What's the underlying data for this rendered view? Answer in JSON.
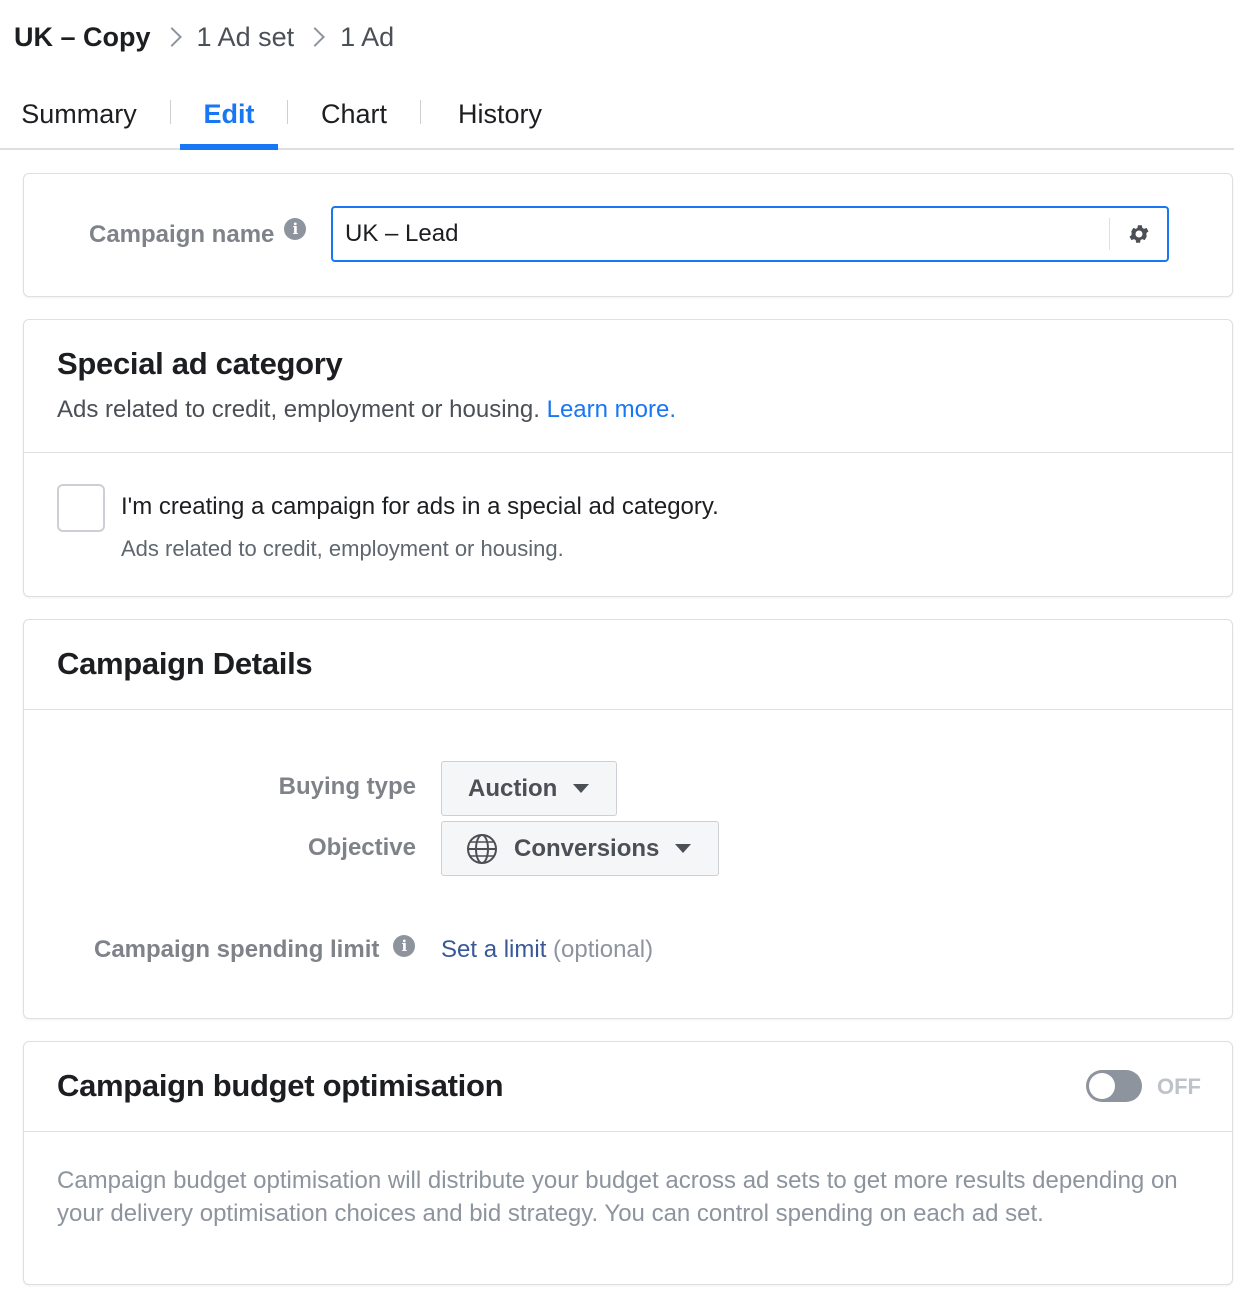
{
  "breadcrumb": {
    "current": "UK – Copy",
    "items": [
      "1 Ad set",
      "1 Ad"
    ]
  },
  "tabs": [
    {
      "label": "Summary",
      "active": false
    },
    {
      "label": "Edit",
      "active": true
    },
    {
      "label": "Chart",
      "active": false
    },
    {
      "label": "History",
      "active": false
    }
  ],
  "campaign_name": {
    "label": "Campaign name",
    "value": "UK – Lead",
    "info_icon": "info-icon",
    "settings_icon": "gear-icon"
  },
  "special_ad_category": {
    "title": "Special ad category",
    "subtitle": "Ads related to credit, employment or housing.",
    "learn_more": "Learn more.",
    "checkbox_label": "I'm creating a campaign for ads in a special ad category.",
    "checkbox_sublabel": "Ads related to credit, employment or housing.",
    "checked": false
  },
  "campaign_details": {
    "title": "Campaign Details",
    "buying_type_label": "Buying type",
    "buying_type_value": "Auction",
    "objective_label": "Objective",
    "objective_value": "Conversions",
    "objective_icon": "globe-icon",
    "spending_limit_label": "Campaign spending limit",
    "spending_limit_link": "Set a limit",
    "spending_limit_optional": "(optional)"
  },
  "budget_optimisation": {
    "title": "Campaign budget optimisation",
    "toggle_state": "OFF",
    "description": "Campaign budget optimisation will distribute your budget across ad sets to get more results depending on your delivery optimisation choices and bid strategy. You can control spending on each ad set."
  },
  "colors": {
    "accent": "#1877f2",
    "link_dark": "#385898",
    "text": "#1c1e21",
    "muted": "#7f8389"
  }
}
